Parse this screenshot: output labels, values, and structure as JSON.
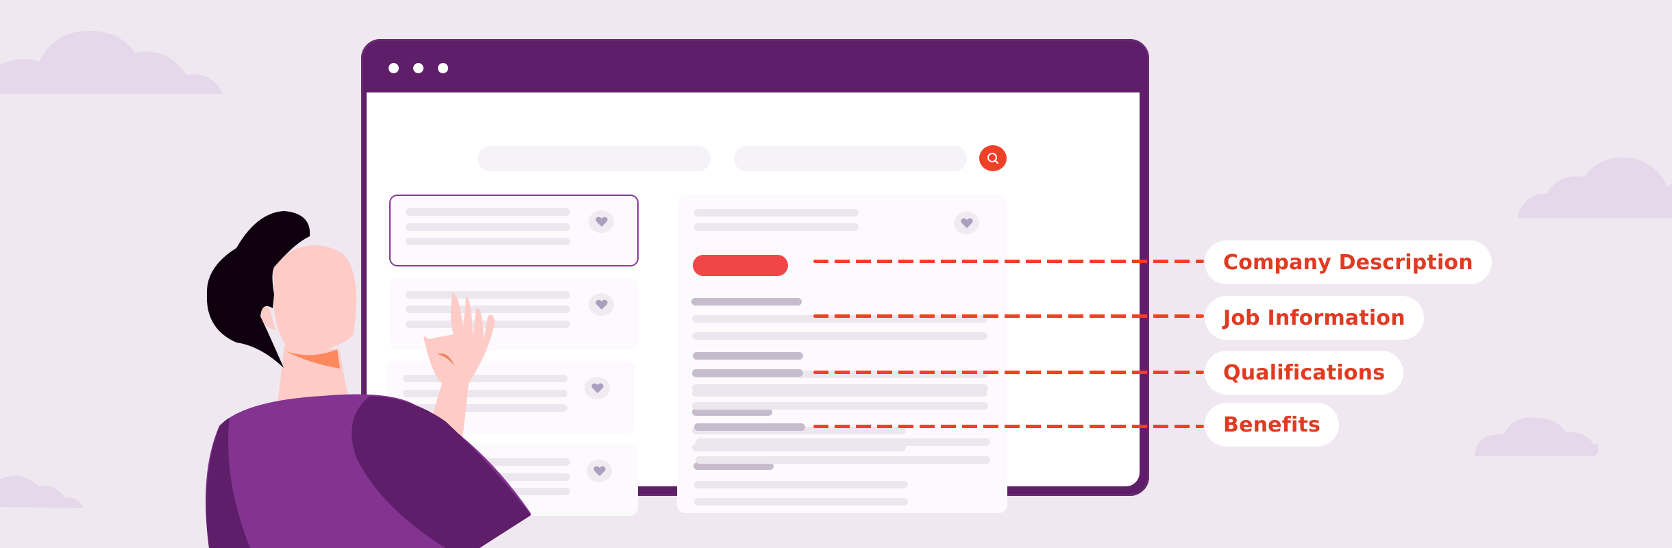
{
  "scene": {
    "background_color": "#efe8f1",
    "cloud_color": "#e5d8ea"
  },
  "browser": {
    "frame_color": "#5f1e69",
    "window_controls": [
      "dot",
      "dot",
      "dot"
    ],
    "search": {
      "input_1_placeholder": "",
      "input_2_placeholder": "",
      "button_icon": "search-icon",
      "button_color": "#ef4128"
    },
    "job_list": {
      "cards": [
        {
          "selected": true,
          "icon": "heart-icon"
        },
        {
          "selected": false,
          "icon": "heart-icon"
        },
        {
          "selected": false,
          "icon": "heart-icon"
        },
        {
          "selected": false,
          "icon": "heart-icon"
        }
      ]
    },
    "job_detail": {
      "favorite_icon": "heart-icon",
      "apply_button_color": "#f04648",
      "sections": [
        "company-description",
        "job-information",
        "qualifications",
        "benefits"
      ]
    }
  },
  "callouts": {
    "color": "#e13a22",
    "items": [
      {
        "label": "Company Description"
      },
      {
        "label": "Job Information"
      },
      {
        "label": "Qualifications"
      },
      {
        "label": "Benefits"
      }
    ]
  }
}
